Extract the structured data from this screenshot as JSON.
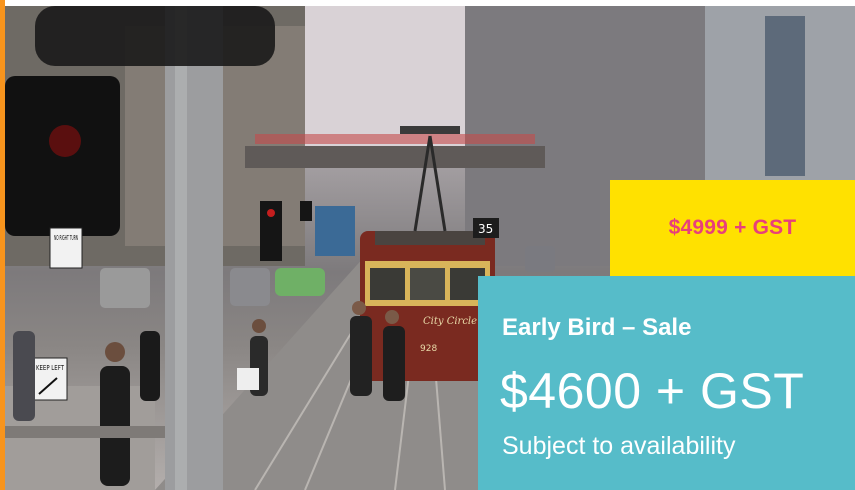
{
  "colors": {
    "accent": "#f7941d",
    "regular_box": "#ffe100",
    "regular_text": "#e8407a",
    "sale_box": "#56bcc9",
    "sale_text": "#ffffff"
  },
  "photo": {
    "signs": {
      "no_right_turn": "NO RIGHT TURN",
      "keep_left": "KEEP LEFT",
      "tram_number": "35",
      "tram_route": "City Circle",
      "tram_id": "928"
    }
  },
  "pricing": {
    "regular_price": "$4999 + GST",
    "sale_label": "Early Bird – Sale",
    "sale_price": "$4600 + GST",
    "availability_note": "Subject to availability"
  }
}
